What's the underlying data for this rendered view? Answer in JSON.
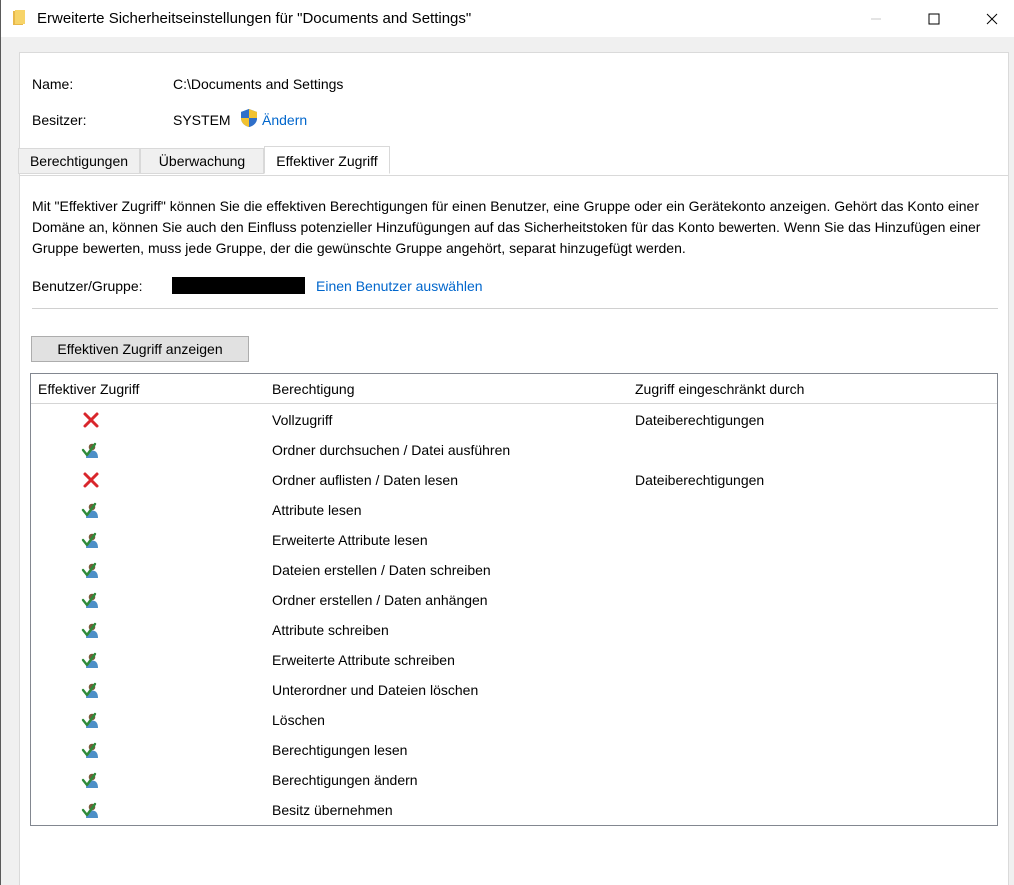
{
  "window": {
    "title": "Erweiterte Sicherheitseinstellungen für \"Documents and Settings\""
  },
  "info": {
    "name_label": "Name:",
    "name_value": "C:\\Documents and Settings",
    "owner_label": "Besitzer:",
    "owner_value": "SYSTEM",
    "owner_change_link": "Ändern"
  },
  "tabs": [
    {
      "label": "Berechtigungen",
      "active": false
    },
    {
      "label": "Überwachung",
      "active": false
    },
    {
      "label": "Effektiver Zugriff",
      "active": true
    }
  ],
  "effective_access": {
    "description": "Mit \"Effektiver Zugriff\" können Sie die effektiven Berechtigungen für einen Benutzer, eine Gruppe oder ein Gerätekonto anzeigen. Gehört das Konto einer Domäne an, können Sie auch den Einfluss potenzieller Hinzufügungen auf das Sicherheitstoken für das Konto bewerten. Wenn Sie das Hinzufügen einer Gruppe bewerten, muss jede Gruppe, der die gewünschte Gruppe angehört, separat hinzugefügt werden.",
    "user_group_label": "Benutzer/Gruppe:",
    "select_user_link": "Einen Benutzer auswählen",
    "show_button": "Effektiven Zugriff anzeigen"
  },
  "table": {
    "columns": [
      "Effektiver Zugriff",
      "Berechtigung",
      "Zugriff eingeschränkt durch"
    ],
    "rows": [
      {
        "access": "denied",
        "icon": "red-x-icon",
        "permission": "Vollzugriff",
        "limited_by": "Dateiberechtigungen"
      },
      {
        "access": "granted",
        "icon": "user-check-icon",
        "permission": "Ordner durchsuchen / Datei ausführen",
        "limited_by": ""
      },
      {
        "access": "denied",
        "icon": "red-x-icon",
        "permission": "Ordner auflisten / Daten lesen",
        "limited_by": "Dateiberechtigungen"
      },
      {
        "access": "granted",
        "icon": "user-check-icon",
        "permission": "Attribute lesen",
        "limited_by": ""
      },
      {
        "access": "granted",
        "icon": "user-check-icon",
        "permission": "Erweiterte Attribute lesen",
        "limited_by": ""
      },
      {
        "access": "granted",
        "icon": "user-check-icon",
        "permission": "Dateien erstellen / Daten schreiben",
        "limited_by": ""
      },
      {
        "access": "granted",
        "icon": "user-check-icon",
        "permission": "Ordner erstellen / Daten anhängen",
        "limited_by": ""
      },
      {
        "access": "granted",
        "icon": "user-check-icon",
        "permission": "Attribute schreiben",
        "limited_by": ""
      },
      {
        "access": "granted",
        "icon": "user-check-icon",
        "permission": "Erweiterte Attribute schreiben",
        "limited_by": ""
      },
      {
        "access": "granted",
        "icon": "user-check-icon",
        "permission": "Unterordner und Dateien löschen",
        "limited_by": ""
      },
      {
        "access": "granted",
        "icon": "user-check-icon",
        "permission": "Löschen",
        "limited_by": ""
      },
      {
        "access": "granted",
        "icon": "user-check-icon",
        "permission": "Berechtigungen lesen",
        "limited_by": ""
      },
      {
        "access": "granted",
        "icon": "user-check-icon",
        "permission": "Berechtigungen ändern",
        "limited_by": ""
      },
      {
        "access": "granted",
        "icon": "user-check-icon",
        "permission": "Besitz übernehmen",
        "limited_by": ""
      }
    ]
  },
  "colors": {
    "link": "#0066cc",
    "denied": "#d9262c",
    "granted_check": "#2e8b3a"
  }
}
